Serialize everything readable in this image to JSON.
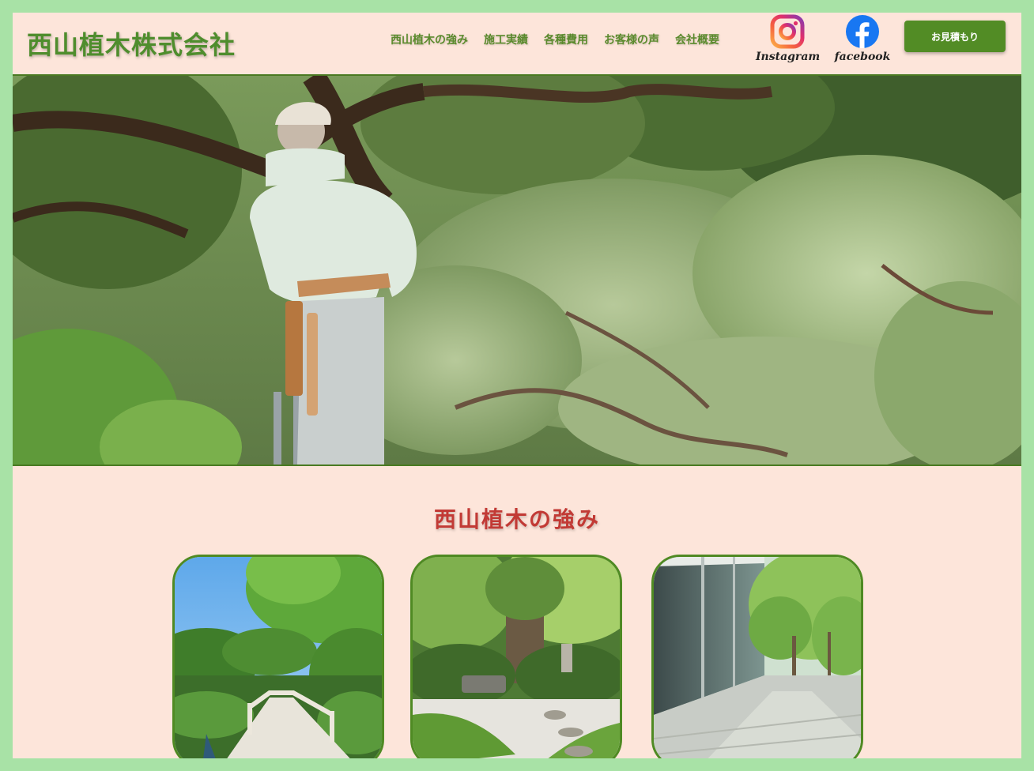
{
  "header": {
    "logo": "西山植木株式会社",
    "nav": [
      {
        "label": "西山植木の強み"
      },
      {
        "label": "施工実績"
      },
      {
        "label": "各種費用"
      },
      {
        "label": "お客様の声"
      },
      {
        "label": "会社概要"
      }
    ],
    "social": {
      "instagram": {
        "label": "Instagram",
        "icon": "instagram-icon"
      },
      "facebook": {
        "label": "facebook",
        "icon": "facebook-icon"
      }
    },
    "quote_button": "お見積もり"
  },
  "hero": {
    "image": "gardener-pruning-pine-tree"
  },
  "strengths": {
    "title": "西山植木の強み",
    "cards": [
      {
        "image": "japanese-garden-bridge"
      },
      {
        "image": "moss-garden-stone-path"
      },
      {
        "image": "building-walkway-trees"
      }
    ]
  },
  "colors": {
    "frame": "#a8e2a6",
    "background": "#fde5da",
    "brand_green": "#528c25",
    "title_red": "#c23a35"
  }
}
